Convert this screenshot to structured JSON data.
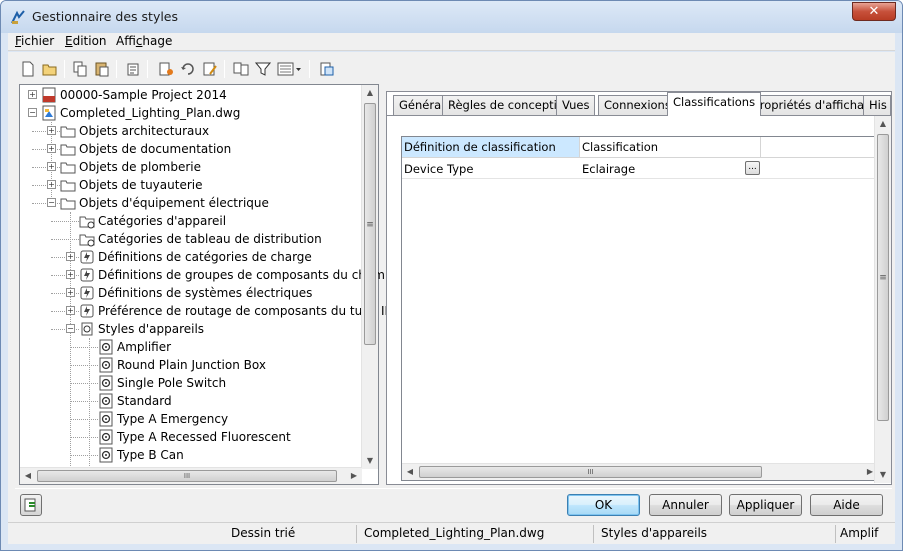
{
  "window": {
    "title": "Gestionnaire des styles",
    "close_label": "✕"
  },
  "menu": [
    {
      "prefix": "",
      "accel": "F",
      "rest": "ichier"
    },
    {
      "prefix": "",
      "accel": "E",
      "rest": "dition"
    },
    {
      "prefix": "Affi",
      "accel": "c",
      "rest": "hage"
    }
  ],
  "tree": {
    "project": "00000-Sample Project 2014",
    "drawing": "Completed_Lighting_Plan.dwg",
    "folders": [
      "Objets architecturaux",
      "Objets de documentation",
      "Objets de plomberie",
      "Objets de tuyauterie",
      "Objets d'équipement électrique"
    ],
    "elec_children": [
      "Catégories d'appareil",
      "Catégories de tableau de distribution",
      "Définitions de catégories de charge",
      "Définitions de groupes de composants du chemin",
      "Définitions de systèmes électriques",
      "Préférence de routage de composants du tube IRO",
      "Styles d'appareils"
    ],
    "styles": [
      "Amplifier",
      "Round Plain Junction Box",
      "Single Pole Switch",
      "Standard",
      "Type A Emergency",
      "Type A Recessed Fluorescent",
      "Type B Can"
    ]
  },
  "tabs": [
    "Général",
    "Règles de conception",
    "Vues",
    "Connexions",
    "Classifications",
    "Propriétés d'affichage",
    "His"
  ],
  "active_tab": "Classifications",
  "grid": {
    "headers": [
      "Définition de classification",
      "Classification"
    ],
    "rows": [
      {
        "definition": "Device Type",
        "classification": "Eclairage",
        "button": "..."
      }
    ]
  },
  "buttons": {
    "ok": "OK",
    "cancel": "Annuler",
    "apply": "Appliquer",
    "help": "Aide"
  },
  "status": {
    "sorted": "Dessin trié",
    "drawing": "Completed_Lighting_Plan.dwg",
    "category": "Styles d'appareils",
    "item": "Amplif"
  },
  "scroll_glyphs": {
    "up": "▲",
    "down": "▼",
    "left": "◀",
    "right": "▶",
    "grip_v": "≡",
    "grip_h": "III"
  },
  "colors": {
    "selection": "#cce8ff",
    "window_frame": "#dbe6f4",
    "close": "#c7513b"
  }
}
